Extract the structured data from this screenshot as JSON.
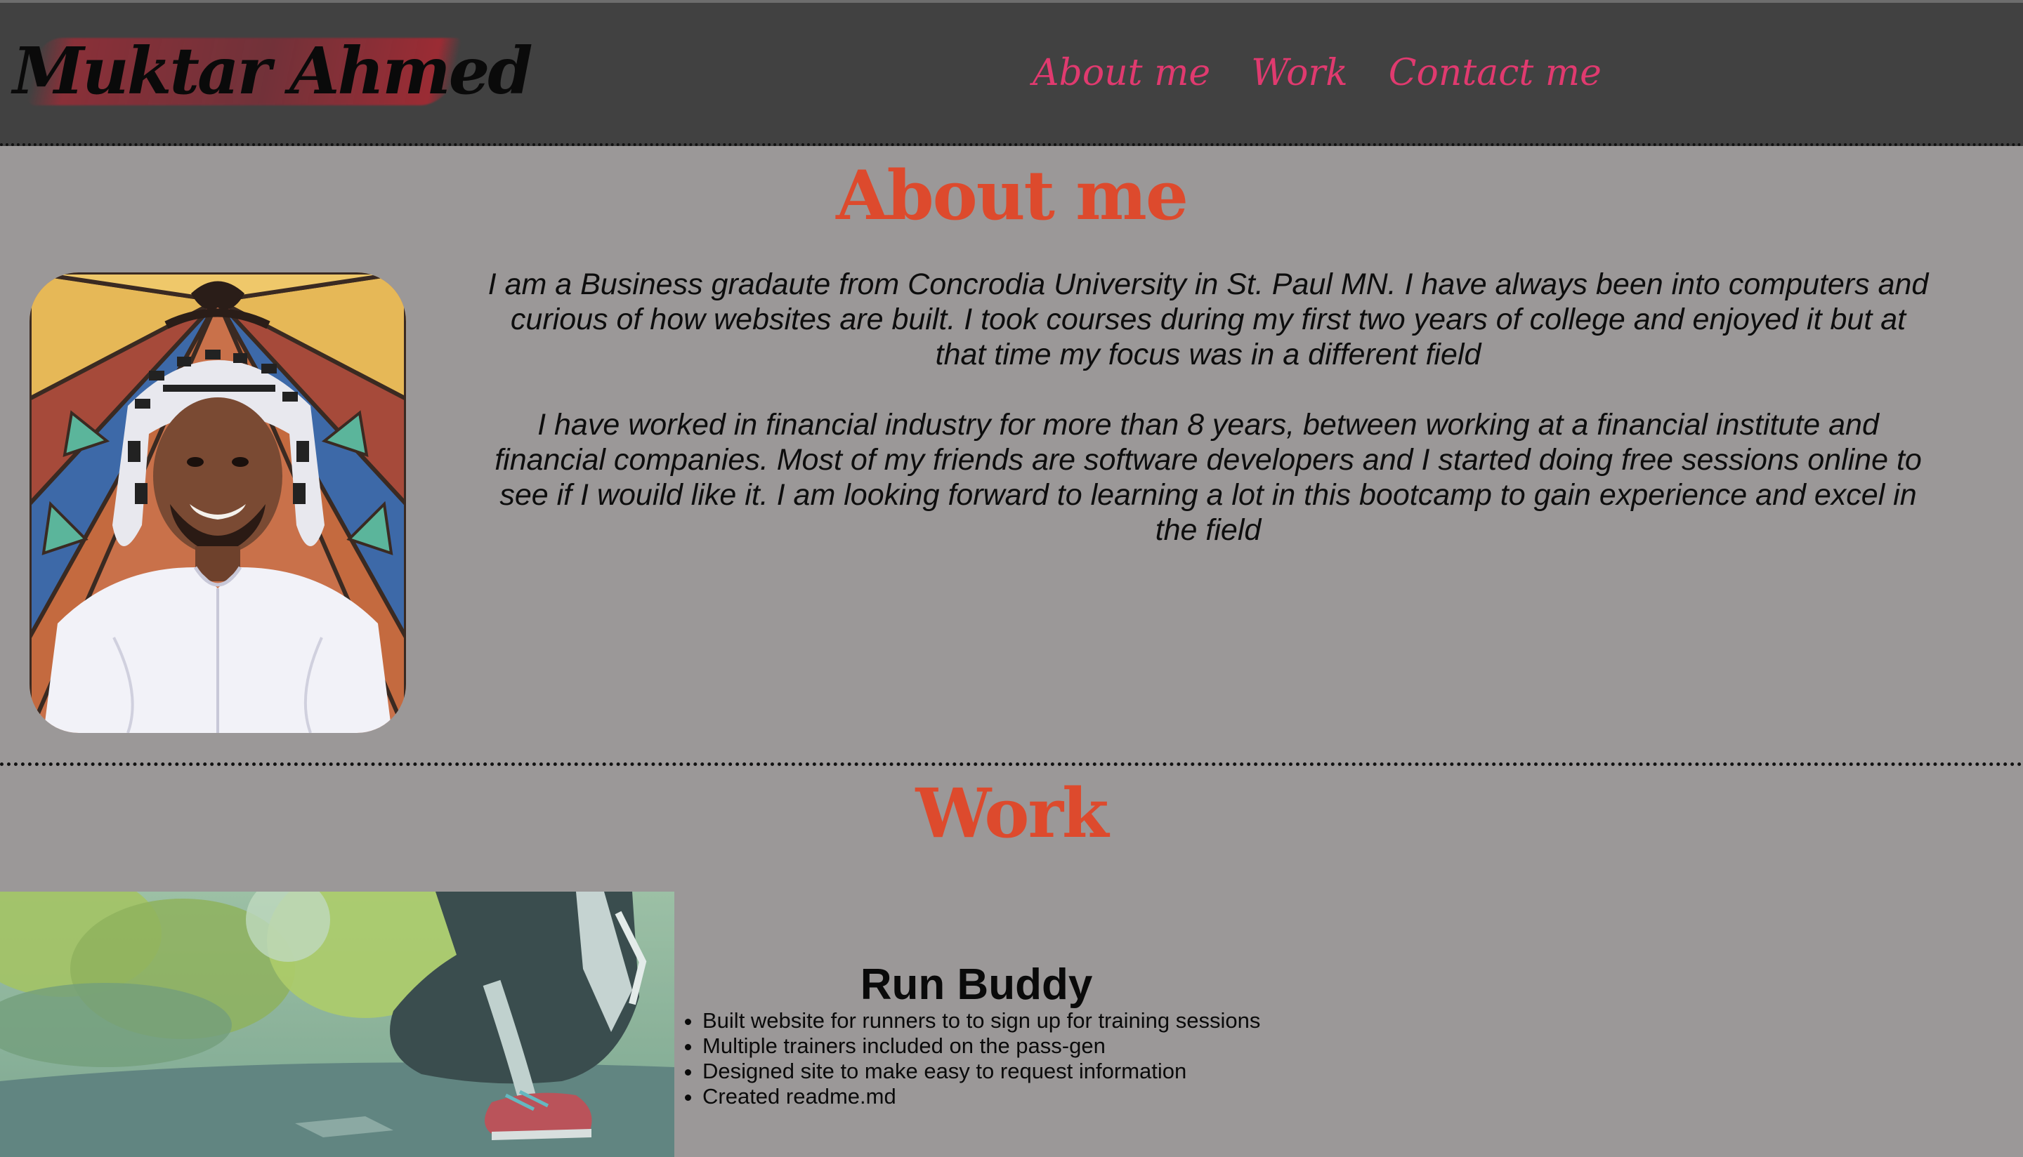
{
  "header": {
    "brand": "Muktar Ahmed",
    "nav": [
      "About me",
      "Work",
      "Contact me"
    ]
  },
  "about": {
    "title": "About me",
    "paragraphs": [
      "I am a Business gradaute from Concrodia University in St. Paul MN. I have always been into computers and curious of how websites are built. I took courses during my first two years of college and enjoyed it but at that time my focus was in a different field",
      "I have worked in financial industry for more than 8 years, between working at a financial institute and financial companies. Most of my friends are software developers and I started doing free sessions online to see if I wouild like it. I am looking forward to learning a lot in this bootcamp to gain experience and excel in the field"
    ]
  },
  "work": {
    "title": "Work",
    "projects": [
      {
        "title": "Run Buddy",
        "bullets": [
          "Built website for runners to to sign up for training sessions",
          "Multiple trainers included on the pass-gen",
          "Designed site to make easy to request information",
          "Created readme.md"
        ]
      }
    ]
  },
  "colors": {
    "header_bg": "#414141",
    "page_bg": "#9b9898",
    "nav_link": "#e03a6f",
    "heading": "#dd4a2d"
  }
}
